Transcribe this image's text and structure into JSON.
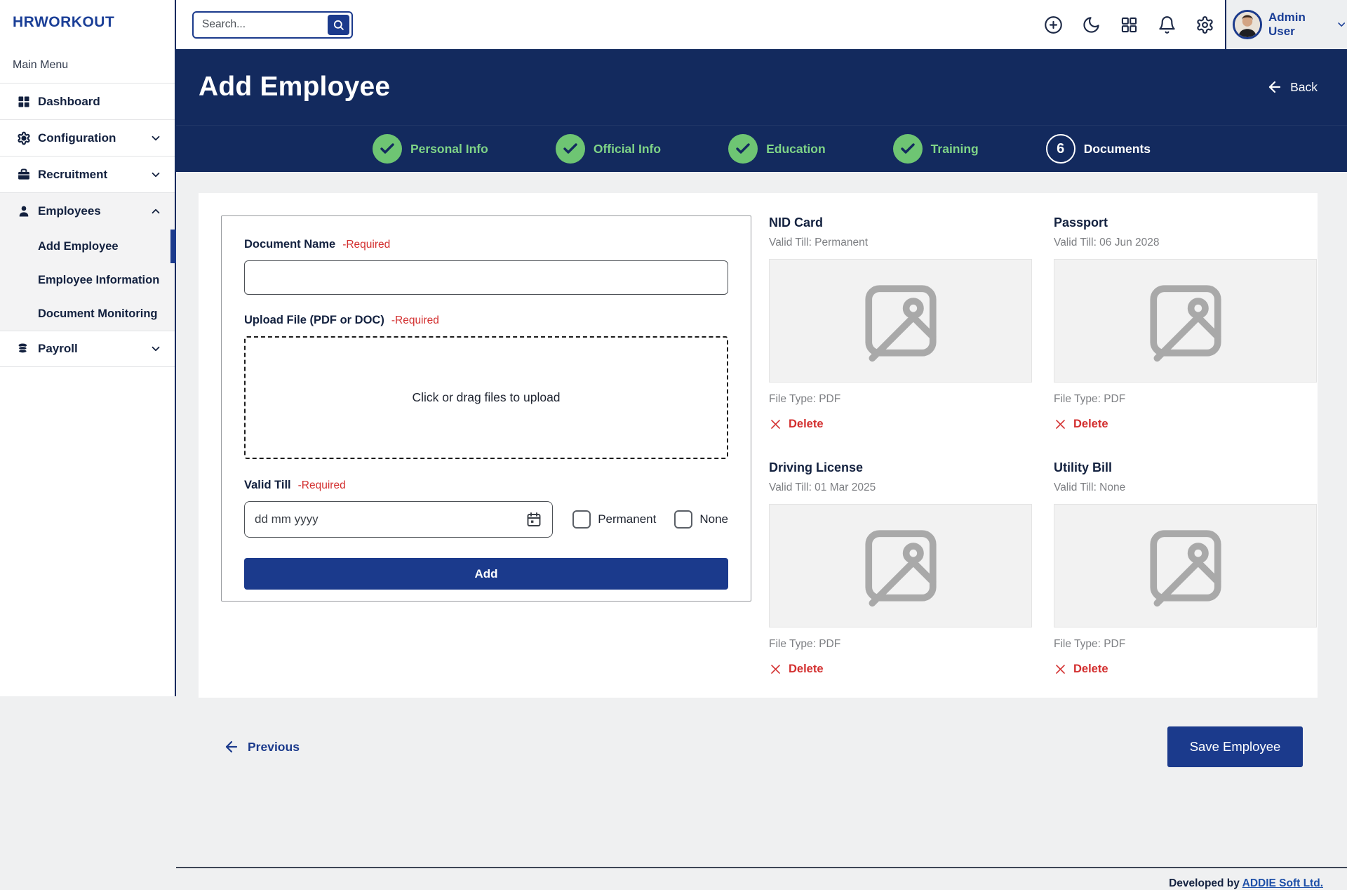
{
  "brand": {
    "logo": "HRWORKOUT"
  },
  "topbar": {
    "search_placeholder": "Search...",
    "icons": [
      "plus-circle-icon",
      "moon-icon",
      "apps-grid-icon",
      "bell-icon",
      "gear-icon"
    ],
    "user": {
      "name": "Admin User"
    }
  },
  "sidebar": {
    "section_label": "Main Menu",
    "items": [
      {
        "label": "Dashboard",
        "icon": "dashboard-icon"
      },
      {
        "label": "Configuration",
        "icon": "gear-icon",
        "chevron": "down"
      },
      {
        "label": "Recruitment",
        "icon": "briefcase-icon",
        "chevron": "down"
      },
      {
        "label": "Employees",
        "icon": "person-icon",
        "chevron": "up",
        "expanded": true
      },
      {
        "label": "Payroll",
        "icon": "coins-icon",
        "chevron": "down"
      }
    ],
    "employees_children": [
      {
        "label": "Add Employee",
        "active": true
      },
      {
        "label": "Employee Information",
        "active": false
      },
      {
        "label": "Document Monitoring",
        "active": false
      }
    ]
  },
  "header": {
    "title": "Add Employee",
    "back_label": "Back"
  },
  "stepper": {
    "steps": [
      {
        "label": "Personal Info",
        "state": "done"
      },
      {
        "label": "Official Info",
        "state": "done"
      },
      {
        "label": "Education",
        "state": "done"
      },
      {
        "label": "Training",
        "state": "done"
      },
      {
        "label": "Documents",
        "state": "current",
        "number": "6"
      }
    ]
  },
  "form": {
    "document_name_label": "Document Name",
    "required_suffix": "-Required",
    "upload_label": "Upload File (PDF or DOC)",
    "dropzone_text": "Click or drag files to upload",
    "valid_till_label": "Valid Till",
    "date_placeholder": "dd mm yyyy",
    "checkbox_permanent": "Permanent",
    "checkbox_none": "None",
    "add_button": "Add"
  },
  "documents": [
    {
      "title": "NID Card",
      "valid_till": "Valid Till: Permanent",
      "file_type": "File Type: PDF",
      "delete_label": "Delete"
    },
    {
      "title": "Passport",
      "valid_till": "Valid Till: 06 Jun 2028",
      "file_type": "File Type: PDF",
      "delete_label": "Delete"
    },
    {
      "title": "Driving License",
      "valid_till": "Valid Till: 01 Mar 2025",
      "file_type": "File Type: PDF",
      "delete_label": "Delete"
    },
    {
      "title": "Utility Bill",
      "valid_till": "Valid Till: None",
      "file_type": "File Type: PDF",
      "delete_label": "Delete"
    }
  ],
  "bottom_nav": {
    "previous_label": "Previous",
    "save_button": "Save Employee"
  },
  "footer": {
    "developed_by": "Developed by",
    "company_link": "ADDIE Soft Ltd."
  },
  "colors": {
    "navy_header": "#132a5e",
    "navy_button": "#1b3a8c",
    "logo_blue": "#1b3f97",
    "step_done_green": "#6ec573",
    "step_label_green": "#7fd487",
    "required_red": "#d32f2f",
    "secondary_gray": "#7d7f83",
    "page_background": "#eff0f1"
  }
}
